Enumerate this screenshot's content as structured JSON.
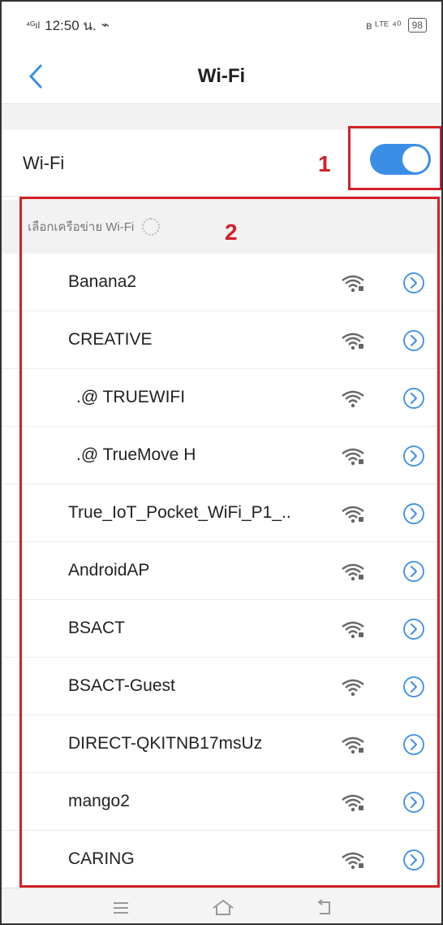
{
  "status": {
    "time": "12:50 น.",
    "carrier_signal": "⁴ᴳıl",
    "right_icons": "ʙ ᴸᵀᴱ ⁴⁰",
    "battery": "98"
  },
  "header": {
    "title": "Wi-Fi",
    "back_icon": "chevron-left-icon"
  },
  "wifi_toggle": {
    "label": "Wi-Fi",
    "enabled": true,
    "accent": "#3a8ee6"
  },
  "annotations": {
    "one": "1",
    "two": "2",
    "color": "#d32027"
  },
  "networks_section": {
    "label": "เลือกเครือข่าย Wi-Fi"
  },
  "networks": [
    {
      "ssid": "Banana2",
      "icon": "wifi-locked-icon",
      "indent": false
    },
    {
      "ssid": "CREATIVE",
      "icon": "wifi-locked-icon",
      "indent": false
    },
    {
      "ssid": ".@ TRUEWIFI",
      "icon": "wifi-icon",
      "indent": true
    },
    {
      "ssid": ".@ TrueMove H",
      "icon": "wifi-locked-icon",
      "indent": true
    },
    {
      "ssid": "True_IoT_Pocket_WiFi_P1_..",
      "icon": "wifi-locked-icon",
      "indent": false
    },
    {
      "ssid": "AndroidAP",
      "icon": "wifi-locked-icon",
      "indent": false
    },
    {
      "ssid": "BSACT",
      "icon": "wifi-locked-icon",
      "indent": false
    },
    {
      "ssid": "BSACT-Guest",
      "icon": "wifi-icon",
      "indent": false
    },
    {
      "ssid": "DIRECT-QKITNB17msUz",
      "icon": "wifi-locked-icon",
      "indent": false
    },
    {
      "ssid": "mango2",
      "icon": "wifi-locked-icon",
      "indent": false
    },
    {
      "ssid": "CARING",
      "icon": "wifi-locked-icon",
      "indent": false
    }
  ],
  "bottom_nav": {
    "menu_icon": "menu-icon",
    "home_icon": "home-icon",
    "back_icon": "back-arrow-icon"
  }
}
